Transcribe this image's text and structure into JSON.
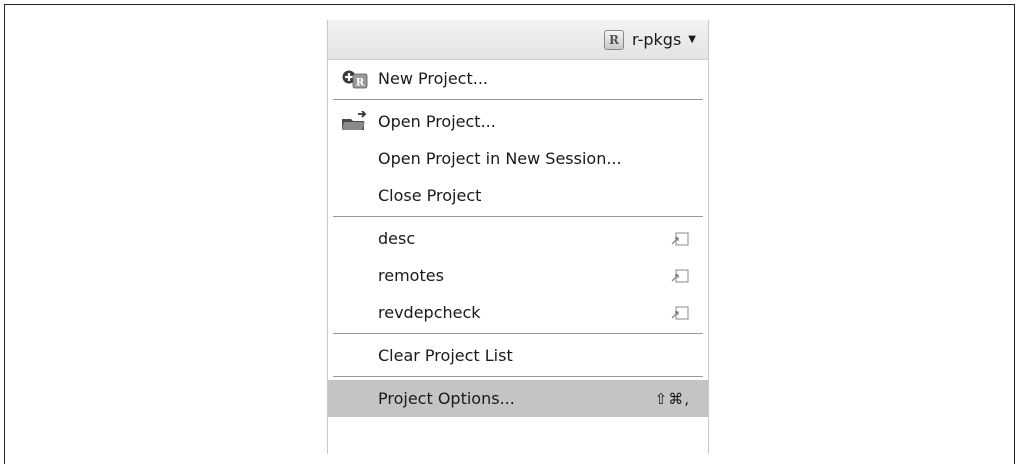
{
  "header": {
    "project_name": "r-pkgs",
    "r_badge": "R"
  },
  "menu": {
    "new_project": "New Project...",
    "open_project": "Open Project...",
    "open_project_new_session": "Open Project in New Session...",
    "close_project": "Close Project",
    "recent_projects": [
      "desc",
      "remotes",
      "revdepcheck"
    ],
    "clear_project_list": "Clear Project List",
    "project_options": "Project Options...",
    "project_options_shortcut": "⇧⌘,"
  },
  "icons": {
    "new_project": "new-project-icon",
    "open_project": "open-folder-icon",
    "open_in_new_session": "open-external-icon",
    "dropdown": "caret-down-icon"
  },
  "colors": {
    "selected_row": "#c4c4c4",
    "separator": "#9a9a9a",
    "header_bg": "#e8e8e8"
  }
}
